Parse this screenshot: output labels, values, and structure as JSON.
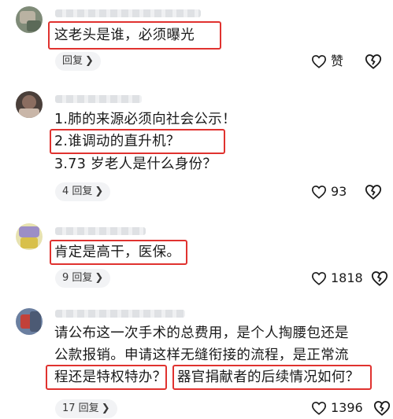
{
  "comments": [
    {
      "lines": [
        "这老头是谁，必须曝光"
      ],
      "reply_label": "回复",
      "like_label": "赞",
      "avatar_colors": [
        "#7f8b78",
        "#b9b2a2",
        "#5b6a58"
      ]
    },
    {
      "lines": [
        "1.肺的来源必须向社会公示！",
        "2.谁调动的直升机？",
        "3.73 岁老人是什么身份？"
      ],
      "reply_label": "4 回复",
      "like_count": "93",
      "avatar_colors": [
        "#4a3f3a",
        "#8b6d60",
        "#c9b6a8"
      ]
    },
    {
      "lines": [
        "肯定是高干，医保。"
      ],
      "reply_label": "9 回复",
      "like_count": "1818",
      "avatar_colors": [
        "#d8c04a",
        "#9c8ec6",
        "#e7e2b0"
      ]
    },
    {
      "lines": [
        "请公布这一次手术的总费用，是个人掏腰包还是",
        "公款报销。申请这样无缝衔接的流程，是正常流",
        "程还是特权特办？",
        "器官捐献者的后续情况如何？"
      ],
      "reply_label": "17 回复",
      "like_count": "1396",
      "avatar_colors": [
        "#6b7fa0",
        "#c2413a",
        "#4c5a74"
      ]
    }
  ],
  "colors": {
    "highlight": "#e0322f",
    "reply_bg": "#f2f3f5"
  },
  "icons": {
    "like": "heart-icon",
    "dislike": "broken-heart-icon",
    "reply": "chevron-right-icon"
  }
}
